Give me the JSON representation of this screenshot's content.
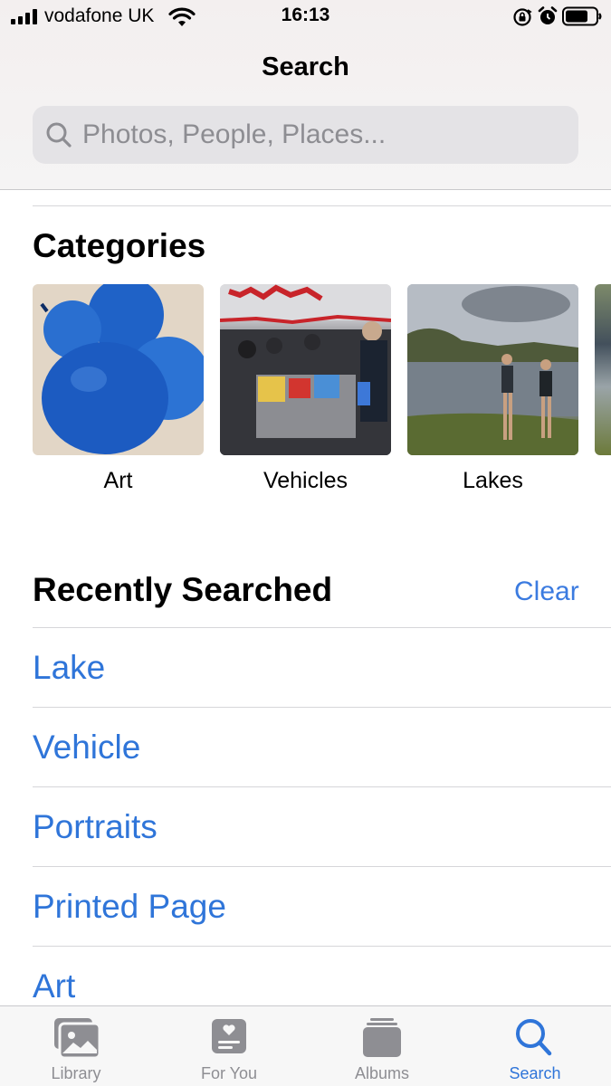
{
  "status_bar": {
    "carrier": "vodafone UK",
    "time": "16:13"
  },
  "header": {
    "title": "Search",
    "search_placeholder": "Photos, People, Places..."
  },
  "categories": {
    "title": "Categories",
    "items": [
      {
        "label": "Art"
      },
      {
        "label": "Vehicles"
      },
      {
        "label": "Lakes"
      }
    ]
  },
  "recent": {
    "title": "Recently Searched",
    "clear_label": "Clear",
    "items": [
      {
        "label": "Lake"
      },
      {
        "label": "Vehicle"
      },
      {
        "label": "Portraits"
      },
      {
        "label": "Printed Page"
      },
      {
        "label": "Art"
      }
    ]
  },
  "tab_bar": {
    "tabs": [
      {
        "label": "Library",
        "icon": "photo-library-icon"
      },
      {
        "label": "For You",
        "icon": "for-you-icon"
      },
      {
        "label": "Albums",
        "icon": "albums-icon"
      },
      {
        "label": "Search",
        "icon": "search-icon",
        "active": true
      }
    ]
  },
  "colors": {
    "accent": "#2f75d9",
    "tab_inactive": "#8e8e93"
  }
}
